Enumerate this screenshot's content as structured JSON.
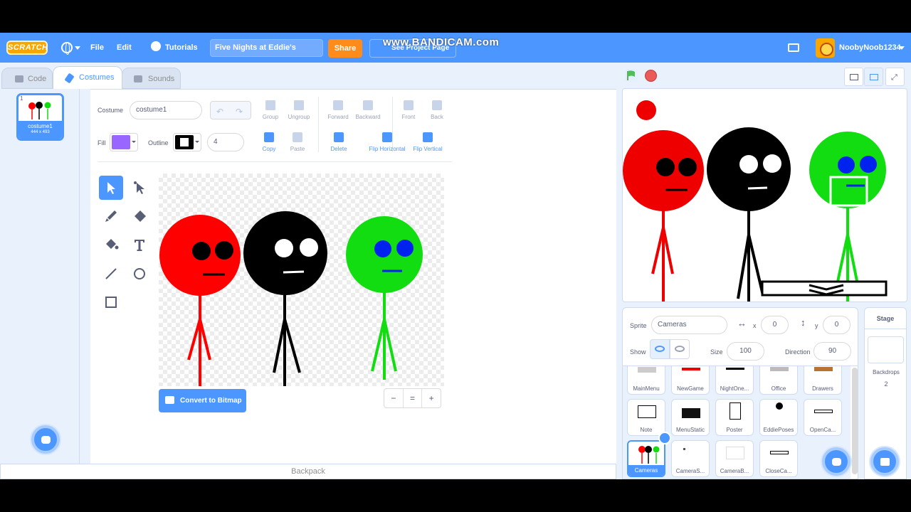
{
  "menu": {
    "logo": "SCRATCH",
    "file": "File",
    "edit": "Edit",
    "tutorials": "Tutorials",
    "project_title": "Five Nights at Eddie's",
    "share": "Share",
    "see_project_page": "See Project Page",
    "watermark": "www.BANDICAM.com",
    "username": "NoobyNoob1234"
  },
  "tabs": {
    "code": "Code",
    "costumes": "Costumes",
    "sounds": "Sounds"
  },
  "costume_list": [
    {
      "index": "1",
      "name": "costume1",
      "size": "444 x 493"
    }
  ],
  "paint": {
    "costume_label": "Costume",
    "costume_name": "costume1",
    "fill_label": "Fill",
    "outline_label": "Outline",
    "outline_width": "4",
    "fill_color": "#9966ff",
    "buttons": {
      "group": "Group",
      "ungroup": "Ungroup",
      "forward": "Forward",
      "backward": "Backward",
      "front": "Front",
      "back": "Back",
      "copy": "Copy",
      "paste": "Paste",
      "delete": "Delete",
      "flip_h": "Flip Horizontal",
      "flip_v": "Flip Vertical"
    },
    "convert_bitmap": "Convert to Bitmap",
    "zoom_out": "−",
    "zoom_reset": "=",
    "zoom_in": "+"
  },
  "backpack": "Backpack",
  "sprite_info": {
    "sprite_label": "Sprite",
    "sprite_name": "Cameras",
    "x_label": "x",
    "x": "0",
    "y_label": "y",
    "y": "0",
    "show_label": "Show",
    "size_label": "Size",
    "size": "100",
    "direction_label": "Direction",
    "direction": "90"
  },
  "sprites": [
    {
      "name": "MainMenu"
    },
    {
      "name": "NewGame"
    },
    {
      "name": "NightOne..."
    },
    {
      "name": "Office"
    },
    {
      "name": "Drawers"
    },
    {
      "name": "Note"
    },
    {
      "name": "MenuStatic"
    },
    {
      "name": "Poster"
    },
    {
      "name": "EddiePoses"
    },
    {
      "name": "OpenCa..."
    },
    {
      "name": "Cameras"
    },
    {
      "name": "CameraS..."
    },
    {
      "name": "CameraB..."
    },
    {
      "name": "CloseCa..."
    }
  ],
  "stage_pane": {
    "title": "Stage",
    "backdrops_label": "Backdrops",
    "backdrops_count": "2"
  },
  "colors": {
    "accent": "#4c97ff",
    "share": "#ff8c1a",
    "red_stick": "#ff0000",
    "green_stick": "#11dd11",
    "eye_blue": "#0022ee"
  }
}
